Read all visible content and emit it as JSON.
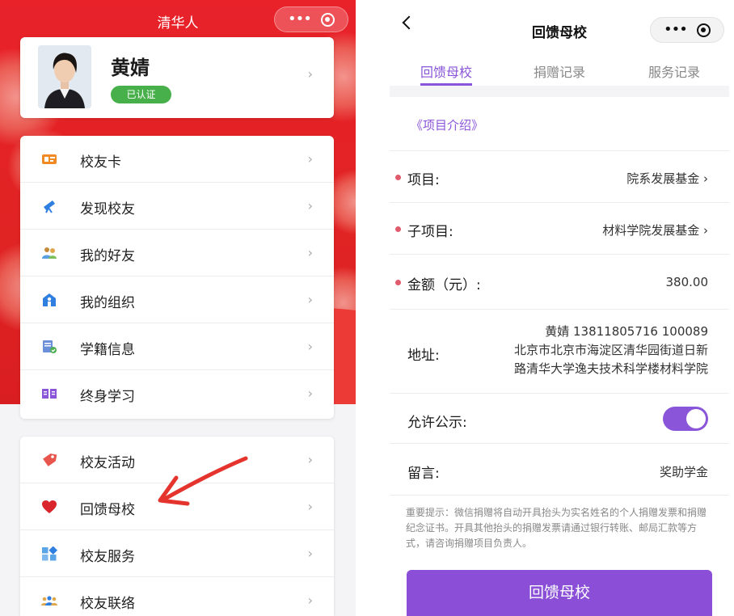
{
  "left": {
    "title": "清华人",
    "profile": {
      "name": "黄婧",
      "badge": "已认证"
    },
    "menu_group1": [
      {
        "label": "校友卡",
        "icon": "card-icon"
      },
      {
        "label": "发现校友",
        "icon": "telescope-icon"
      },
      {
        "label": "我的好友",
        "icon": "friends-icon"
      },
      {
        "label": "我的组织",
        "icon": "organization-icon"
      },
      {
        "label": "学籍信息",
        "icon": "student-record-icon"
      },
      {
        "label": "终身学习",
        "icon": "book-icon"
      }
    ],
    "menu_group2": [
      {
        "label": "校友活动",
        "icon": "tag-icon"
      },
      {
        "label": "回馈母校",
        "icon": "heart-icon"
      },
      {
        "label": "校友服务",
        "icon": "grid-icon"
      },
      {
        "label": "校友联络",
        "icon": "group-icon"
      }
    ],
    "chevron": "›",
    "colors": {
      "header_red": "#e02323",
      "verified_green": "#48b04a",
      "arrow_red": "#e5332e"
    }
  },
  "right": {
    "title": "回馈母校",
    "tabs": [
      "回馈母校",
      "捐赠记录",
      "服务记录"
    ],
    "intro_link": "《项目介绍》",
    "fields": {
      "project": {
        "label": "项目:",
        "value": "院系发展基金 ›"
      },
      "sub_project": {
        "label": "子项目:",
        "value": "材料学院发展基金 ›"
      },
      "amount": {
        "label": "金额（元）:",
        "value": "380.00"
      },
      "address": {
        "label": "地址:",
        "lines": [
          "黄婧 13811805716 100089",
          "北京市北京市海淀区清华园街道日新",
          "路清华大学逸夫技术科学楼材料学院"
        ]
      },
      "public": {
        "label": "允许公示:",
        "enabled": true
      },
      "message": {
        "label": "留言:",
        "value": "奖助学金"
      }
    },
    "notice": "重要提示：微信捐赠将自动开具抬头为实名姓名的个人捐赠发票和捐赠纪念证书。开具其他抬头的捐赠发票请通过银行转账、邮局汇款等方式，请咨询捐赠项目负责人。",
    "submit_label": "回馈母校",
    "colors": {
      "accent_purple": "#8a55d8",
      "required_dot": "#e05b6b"
    }
  }
}
